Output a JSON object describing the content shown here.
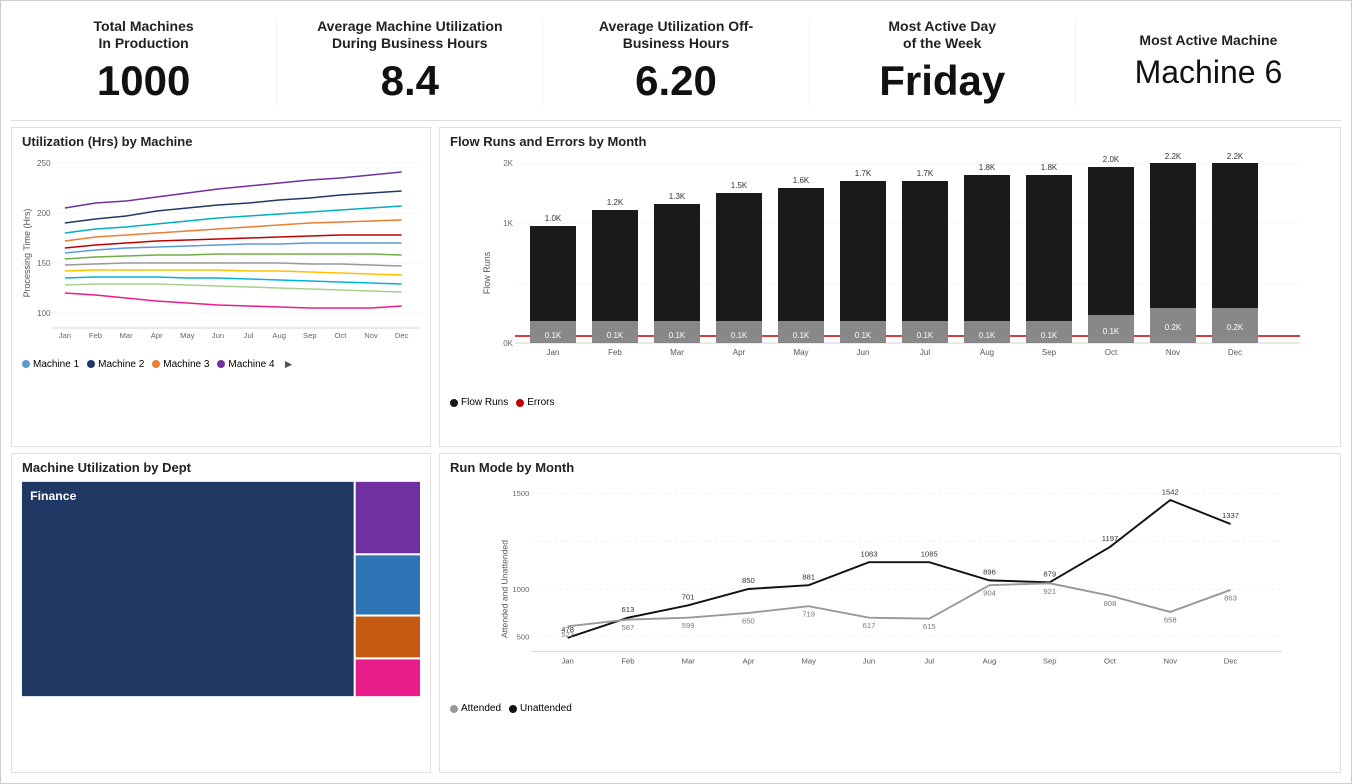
{
  "kpis": [
    {
      "id": "total-machines",
      "label": "Total Machines\nIn Production",
      "value": "1000",
      "size": "large"
    },
    {
      "id": "avg-utilization-biz",
      "label": "Average Machine Utilization\nDuring Business Hours",
      "value": "8.4",
      "size": "large"
    },
    {
      "id": "avg-utilization-offbiz",
      "label": "Average Utilization Off-\nBusiness Hours",
      "value": "6.20",
      "size": "large"
    },
    {
      "id": "most-active-day",
      "label": "Most Active Day\nof the Week",
      "value": "Friday",
      "size": "large"
    },
    {
      "id": "most-active-machine",
      "label": "Most Active Machine",
      "value": "Machine 6",
      "size": "medium"
    }
  ],
  "utilization_chart": {
    "title": "Utilization (Hrs) by Machine",
    "y_label": "Processing Time (Hrs)",
    "x_labels": [
      "Jan",
      "Feb",
      "Mar",
      "Apr",
      "May",
      "Jun",
      "Jul",
      "Aug",
      "Sep",
      "Oct",
      "Nov",
      "Dec"
    ],
    "y_min": 100,
    "y_max": 250,
    "legend": [
      {
        "label": "Machine 1",
        "color": "#5b9bd5"
      },
      {
        "label": "Machine 2",
        "color": "#1f3864"
      },
      {
        "label": "Machine 3",
        "color": "#ed7d31"
      },
      {
        "label": "Machine 4",
        "color": "#7030a0"
      }
    ]
  },
  "flow_runs_chart": {
    "title": "Flow Runs and Errors by Month",
    "x_labels": [
      "Jan",
      "Feb",
      "Mar",
      "Apr",
      "May",
      "Jun",
      "Jul",
      "Aug",
      "Sep",
      "Oct",
      "Nov",
      "Dec"
    ],
    "flow_runs": [
      1000,
      1200,
      1300,
      1500,
      1600,
      1700,
      1700,
      1800,
      1800,
      2000,
      2200,
      2200
    ],
    "errors": [
      100,
      100,
      100,
      100,
      100,
      100,
      100,
      100,
      100,
      100,
      200,
      200
    ],
    "flow_labels": [
      "1.0K",
      "1.2K",
      "1.3K",
      "1.5K",
      "1.6K",
      "1.7K",
      "1.7K",
      "1.8K",
      "1.8K",
      "2.0K",
      "2.2K",
      "2.2K"
    ],
    "error_labels": [
      "0.1K",
      "0.1K",
      "0.1K",
      "0.1K",
      "0.1K",
      "0.1K",
      "0.1K",
      "0.1K",
      "0.1K",
      "0.1K",
      "0.2K",
      "0.2K"
    ],
    "legend": [
      {
        "label": "Flow Runs",
        "color": "#1a1a1a"
      },
      {
        "label": "Errors",
        "color": "#c00000"
      }
    ]
  },
  "treemap": {
    "title": "Machine Utilization by Dept",
    "items": [
      {
        "label": "Finance",
        "color": "#1f3864",
        "width": 84,
        "height": 100
      },
      {
        "label": "",
        "color": "#7030a0",
        "width": 16,
        "height": 35
      },
      {
        "label": "",
        "color": "#2e75b6",
        "width": 16,
        "height": 30
      },
      {
        "label": "",
        "color": "#c55a11",
        "width": 16,
        "height": 20
      },
      {
        "label": "",
        "color": "#e91e8c",
        "width": 16,
        "height": 15
      }
    ]
  },
  "run_mode_chart": {
    "title": "Run Mode by Month",
    "x_labels": [
      "Jan",
      "Feb",
      "Mar",
      "Apr",
      "May",
      "Jun",
      "Jul",
      "Aug",
      "Sep",
      "Oct",
      "Nov",
      "Dec"
    ],
    "attended": [
      522,
      587,
      599,
      650,
      719,
      617,
      615,
      904,
      921,
      808,
      658,
      863
    ],
    "unattended": [
      478,
      613,
      701,
      850,
      881,
      1083,
      1085,
      896,
      879,
      1197,
      1542,
      1337
    ],
    "y_min": 500,
    "y_max": 1500,
    "legend": [
      {
        "label": "Attended",
        "color": "#999999"
      },
      {
        "label": "Unattended",
        "color": "#111111"
      }
    ]
  }
}
